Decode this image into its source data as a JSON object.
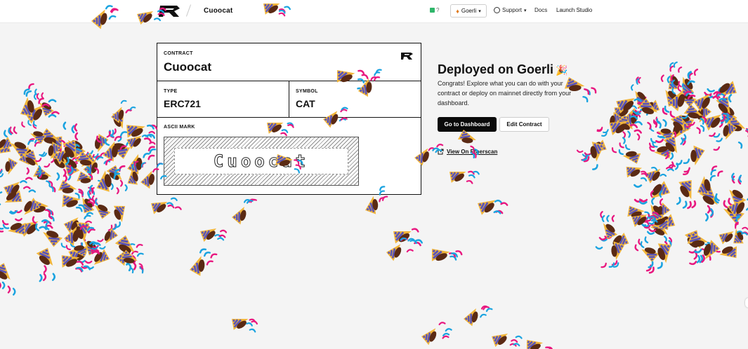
{
  "nav": {
    "project": "Cuoocat",
    "gas_value": "?",
    "network": "Goerli",
    "support_label": "Support",
    "docs_label": "Docs",
    "studio_label": "Launch Studio"
  },
  "contract": {
    "header_label": "CONTRACT",
    "name": "Cuoocat",
    "type_label": "TYPE",
    "type_value": "ERC721",
    "symbol_label": "SYMBOL",
    "symbol_value": "CAT",
    "ascii_label": "ASCII MARK",
    "ascii_text": "Cuoocat"
  },
  "deploy": {
    "title": "Deployed on Goerli",
    "description": "Congrats! Explore what you can do with your contract or deploy on mainnet directly from your dashboard.",
    "dashboard_button": "Go to Dashboard",
    "edit_button": "Edit Contract",
    "etherscan_link": "View On Etherscan"
  },
  "colors": {
    "accent_dark": "#0a0a0a",
    "confetti_pink": "#e8177f",
    "confetti_blue": "#1aa3e0",
    "confetti_yellow": "#f2b63a",
    "confetti_purple": "#5a54b8",
    "confetti_brown": "#5a2a14"
  },
  "icons": [
    "logo-icon",
    "eth-icon",
    "globe-icon",
    "chevron-down-icon",
    "external-link-icon",
    "party-popper-icon"
  ]
}
